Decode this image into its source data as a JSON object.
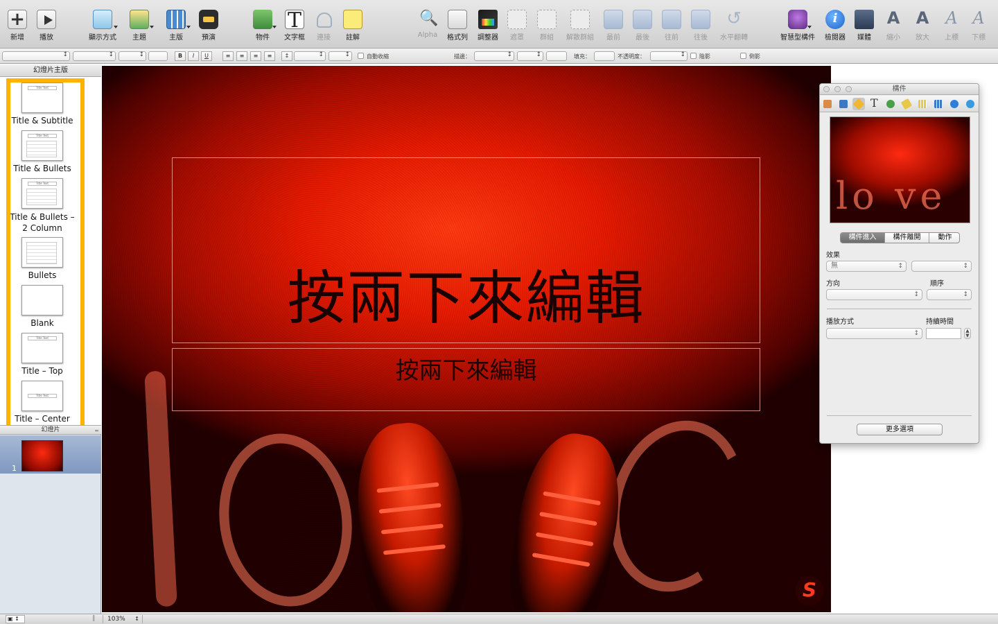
{
  "toolbar": {
    "new": "新增",
    "play": "播放",
    "view": "顯示方式",
    "themes": "主題",
    "masters": "主版",
    "preview": "預演",
    "shapes": "物件",
    "textbox": "文字框",
    "connect": "連接",
    "comment": "註解",
    "alpha": "Alpha",
    "format_bar": "格式列",
    "adjust": "調整器",
    "mask": "遮罩",
    "group": "群組",
    "ungroup": "解散群組",
    "front": "最前",
    "back": "最後",
    "forward": "往前",
    "backward": "往後",
    "flip": "水平翻轉",
    "smart_builds": "智慧型構件",
    "inspector": "檢閱器",
    "media": "媒體",
    "smaller": "縮小",
    "bigger": "放大",
    "superscript": "上標",
    "subscript": "下標"
  },
  "formatbar": {
    "bold": "B",
    "italic": "I",
    "underline": "U",
    "autoshrink": "自動收縮",
    "stroke": "描邊：",
    "fill": "填充：",
    "opacity": "不透明度：",
    "shadow": "陰影",
    "reflection": "倒影"
  },
  "sidebar": {
    "masters_header": "幻燈片主版",
    "slides_header": "幻燈片",
    "masters": [
      {
        "label": "Title & Subtitle",
        "thumb_title": "Title Text"
      },
      {
        "label": "Title & Bullets",
        "thumb_title": "Title Text"
      },
      {
        "label": "Title & Bullets – 2 Column",
        "thumb_title": "Title Text"
      },
      {
        "label": "Bullets",
        "thumb_title": ""
      },
      {
        "label": "Blank",
        "thumb_title": ""
      },
      {
        "label": "Title – Top",
        "thumb_title": "Title Text"
      },
      {
        "label": "Title – Center",
        "thumb_title": "Title Text"
      }
    ],
    "slide_number": "1"
  },
  "slide": {
    "title": "按兩下來編輯",
    "subtitle": "按兩下來編輯",
    "logo_letter": "S"
  },
  "inspector": {
    "window_title": "構件",
    "segments": [
      "構件進入",
      "構件離開",
      "動作"
    ],
    "active_segment": 0,
    "effect_label": "效果",
    "effect_value": "無",
    "direction_label": "方向",
    "order_label": "順序",
    "delivery_label": "播放方式",
    "duration_label": "持續時間",
    "more_options": "更多選項"
  },
  "statusbar": {
    "zoom": "103%"
  },
  "colors": {
    "master_highlight": "#ffb300",
    "slide_red": "#e51a00"
  }
}
